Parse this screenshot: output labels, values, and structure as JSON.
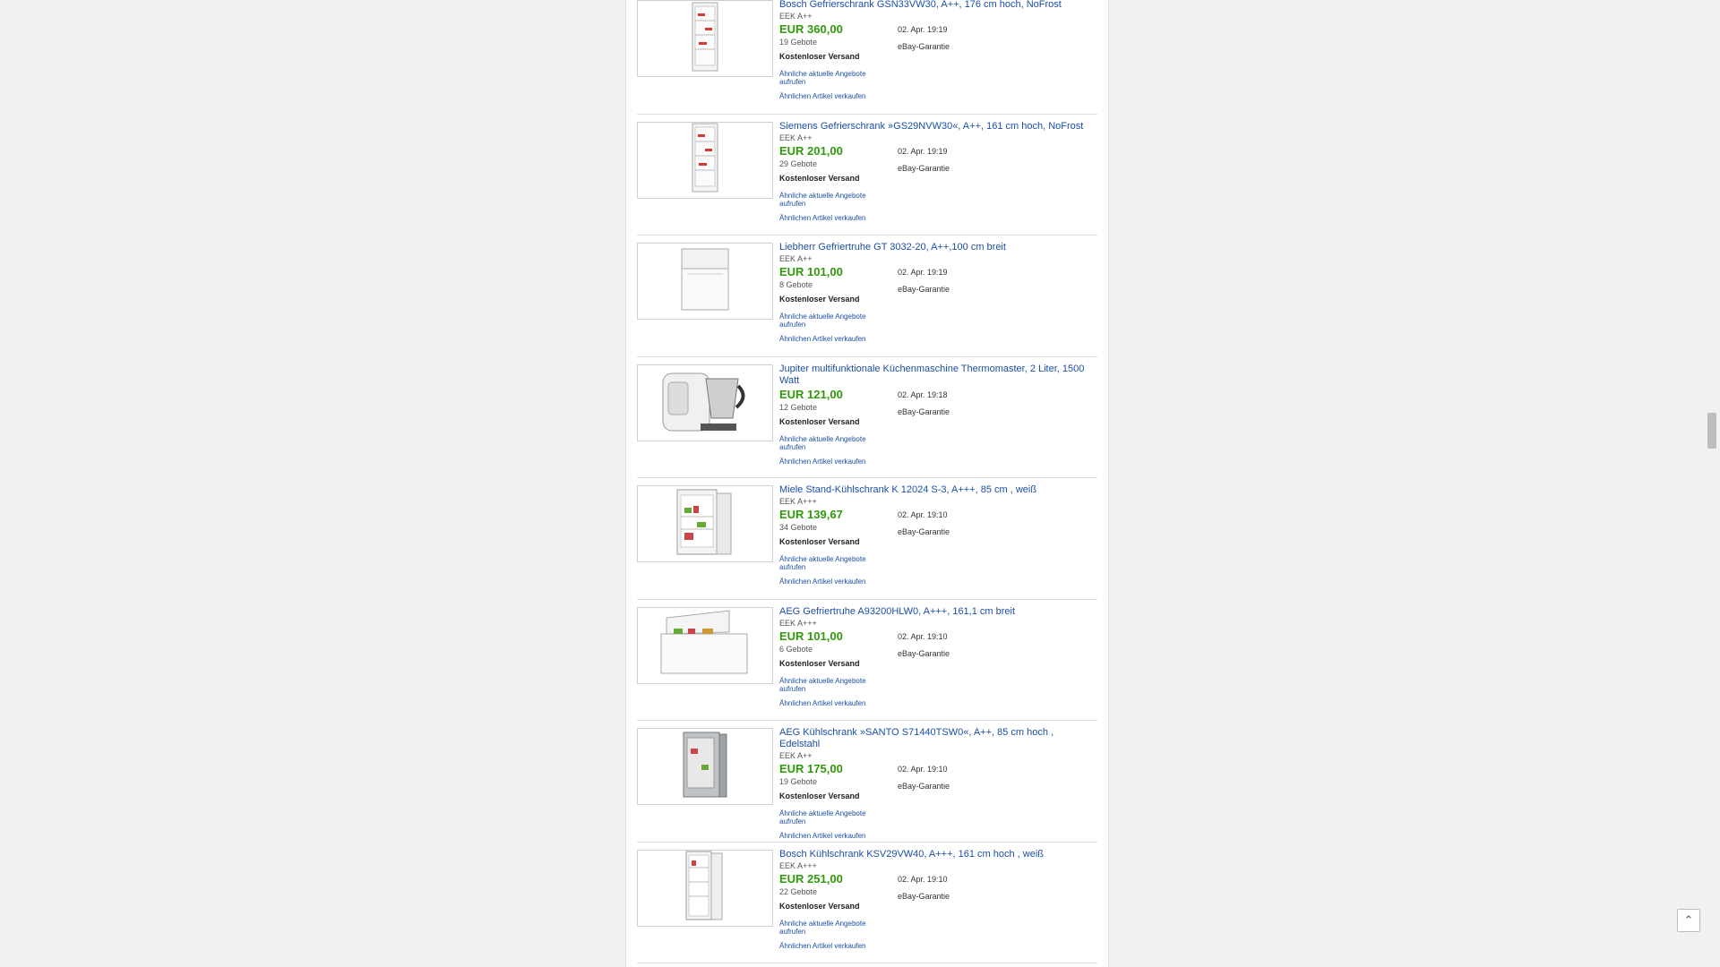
{
  "listings": [
    {
      "image": "freezer-tall-icon",
      "title": "Bosch Gefrierschrank GSN33VW30, A++, 176 cm hoch, NoFrost",
      "eek": "EEK A++",
      "price": "EUR 360,00",
      "bids": "19 Gebote",
      "shipping": "Kostenloser Versand",
      "date": "02. Apr. 19:19",
      "guarantee": "eBay-Garantie",
      "similar_link": "Ähnliche aktuelle Angebote aufrufen",
      "sell_link": "Ähnlichen Artikel verkaufen"
    },
    {
      "image": "freezer-tall-icon",
      "title": "Siemens Gefrierschrank »GS29NVW30«, A++, 161 cm hoch, NoFrost",
      "eek": "EEK A++",
      "price": "EUR 201,00",
      "bids": "29 Gebote",
      "shipping": "Kostenloser Versand",
      "date": "02. Apr. 19:19",
      "guarantee": "eBay-Garantie",
      "similar_link": "Ähnliche aktuelle Angebote aufrufen",
      "sell_link": "Ähnlichen Artikel verkaufen"
    },
    {
      "image": "chest-freezer-icon",
      "title": "Liebherr Gefriertruhe GT 3032-20, A++,100 cm breit",
      "eek": "EEK A++",
      "price": "EUR 101,00",
      "bids": "8 Gebote",
      "shipping": "Kostenloser Versand",
      "date": "02. Apr. 19:19",
      "guarantee": "eBay-Garantie",
      "similar_link": "Ähnliche aktuelle Angebote aufrufen",
      "sell_link": "Ähnlichen Artikel verkaufen"
    },
    {
      "image": "kitchen-machine-icon",
      "title": "Jupiter multifunktionale Küchenmaschine Thermomaster, 2 Liter, 1500 Watt",
      "eek": "",
      "price": "EUR 121,00",
      "bids": "12 Gebote",
      "shipping": "Kostenloser Versand",
      "date": "02. Apr. 19:18",
      "guarantee": "eBay-Garantie",
      "similar_link": "Ähnliche aktuelle Angebote aufrufen",
      "sell_link": "Ähnlichen Artikel verkaufen"
    },
    {
      "image": "fridge-open-icon",
      "title": "Miele Stand-Kühlschrank K 12024 S-3, A+++, 85 cm , weiß",
      "eek": "EEK A+++",
      "price": "EUR 139,67",
      "bids": "34 Gebote",
      "shipping": "Kostenloser Versand",
      "date": "02. Apr. 19:10",
      "guarantee": "eBay-Garantie",
      "similar_link": "Ähnliche aktuelle Angebote aufrufen",
      "sell_link": "Ähnlichen Artikel verkaufen"
    },
    {
      "image": "chest-freezer-open-icon",
      "title": "AEG Gefriertruhe A93200HLW0, A+++, 161,1 cm breit",
      "eek": "EEK A+++",
      "price": "EUR 101,00",
      "bids": "6 Gebote",
      "shipping": "Kostenloser Versand",
      "date": "02. Apr. 19:10",
      "guarantee": "eBay-Garantie",
      "similar_link": "Ähnliche aktuelle Angebote aufrufen",
      "sell_link": "Ähnlichen Artikel verkaufen"
    },
    {
      "image": "fridge-steel-icon",
      "title": "AEG Kühlschrank »SANTO S71440TSW0«, A++, 85 cm hoch , Edelstahl",
      "eek": "EEK A++",
      "price": "EUR 175,00",
      "bids": "19 Gebote",
      "shipping": "Kostenloser Versand",
      "date": "02. Apr. 19:10",
      "guarantee": "eBay-Garantie",
      "similar_link": "Ähnliche aktuelle Angebote aufrufen",
      "sell_link": "Ähnlichen Artikel verkaufen"
    },
    {
      "image": "fridge-tall-icon",
      "title": "Bosch Kühlschrank KSV29VW40, A+++, 161 cm hoch , weiß",
      "eek": "EEK A+++",
      "price": "EUR 251,00",
      "bids": "22 Gebote",
      "shipping": "Kostenloser Versand",
      "date": "02. Apr. 19:10",
      "guarantee": "eBay-Garantie",
      "similar_link": "Ähnliche aktuelle Angebote aufrufen",
      "sell_link": "Ähnlichen Artikel verkaufen"
    }
  ],
  "scroll_top_icon": "chevron-up-icon"
}
